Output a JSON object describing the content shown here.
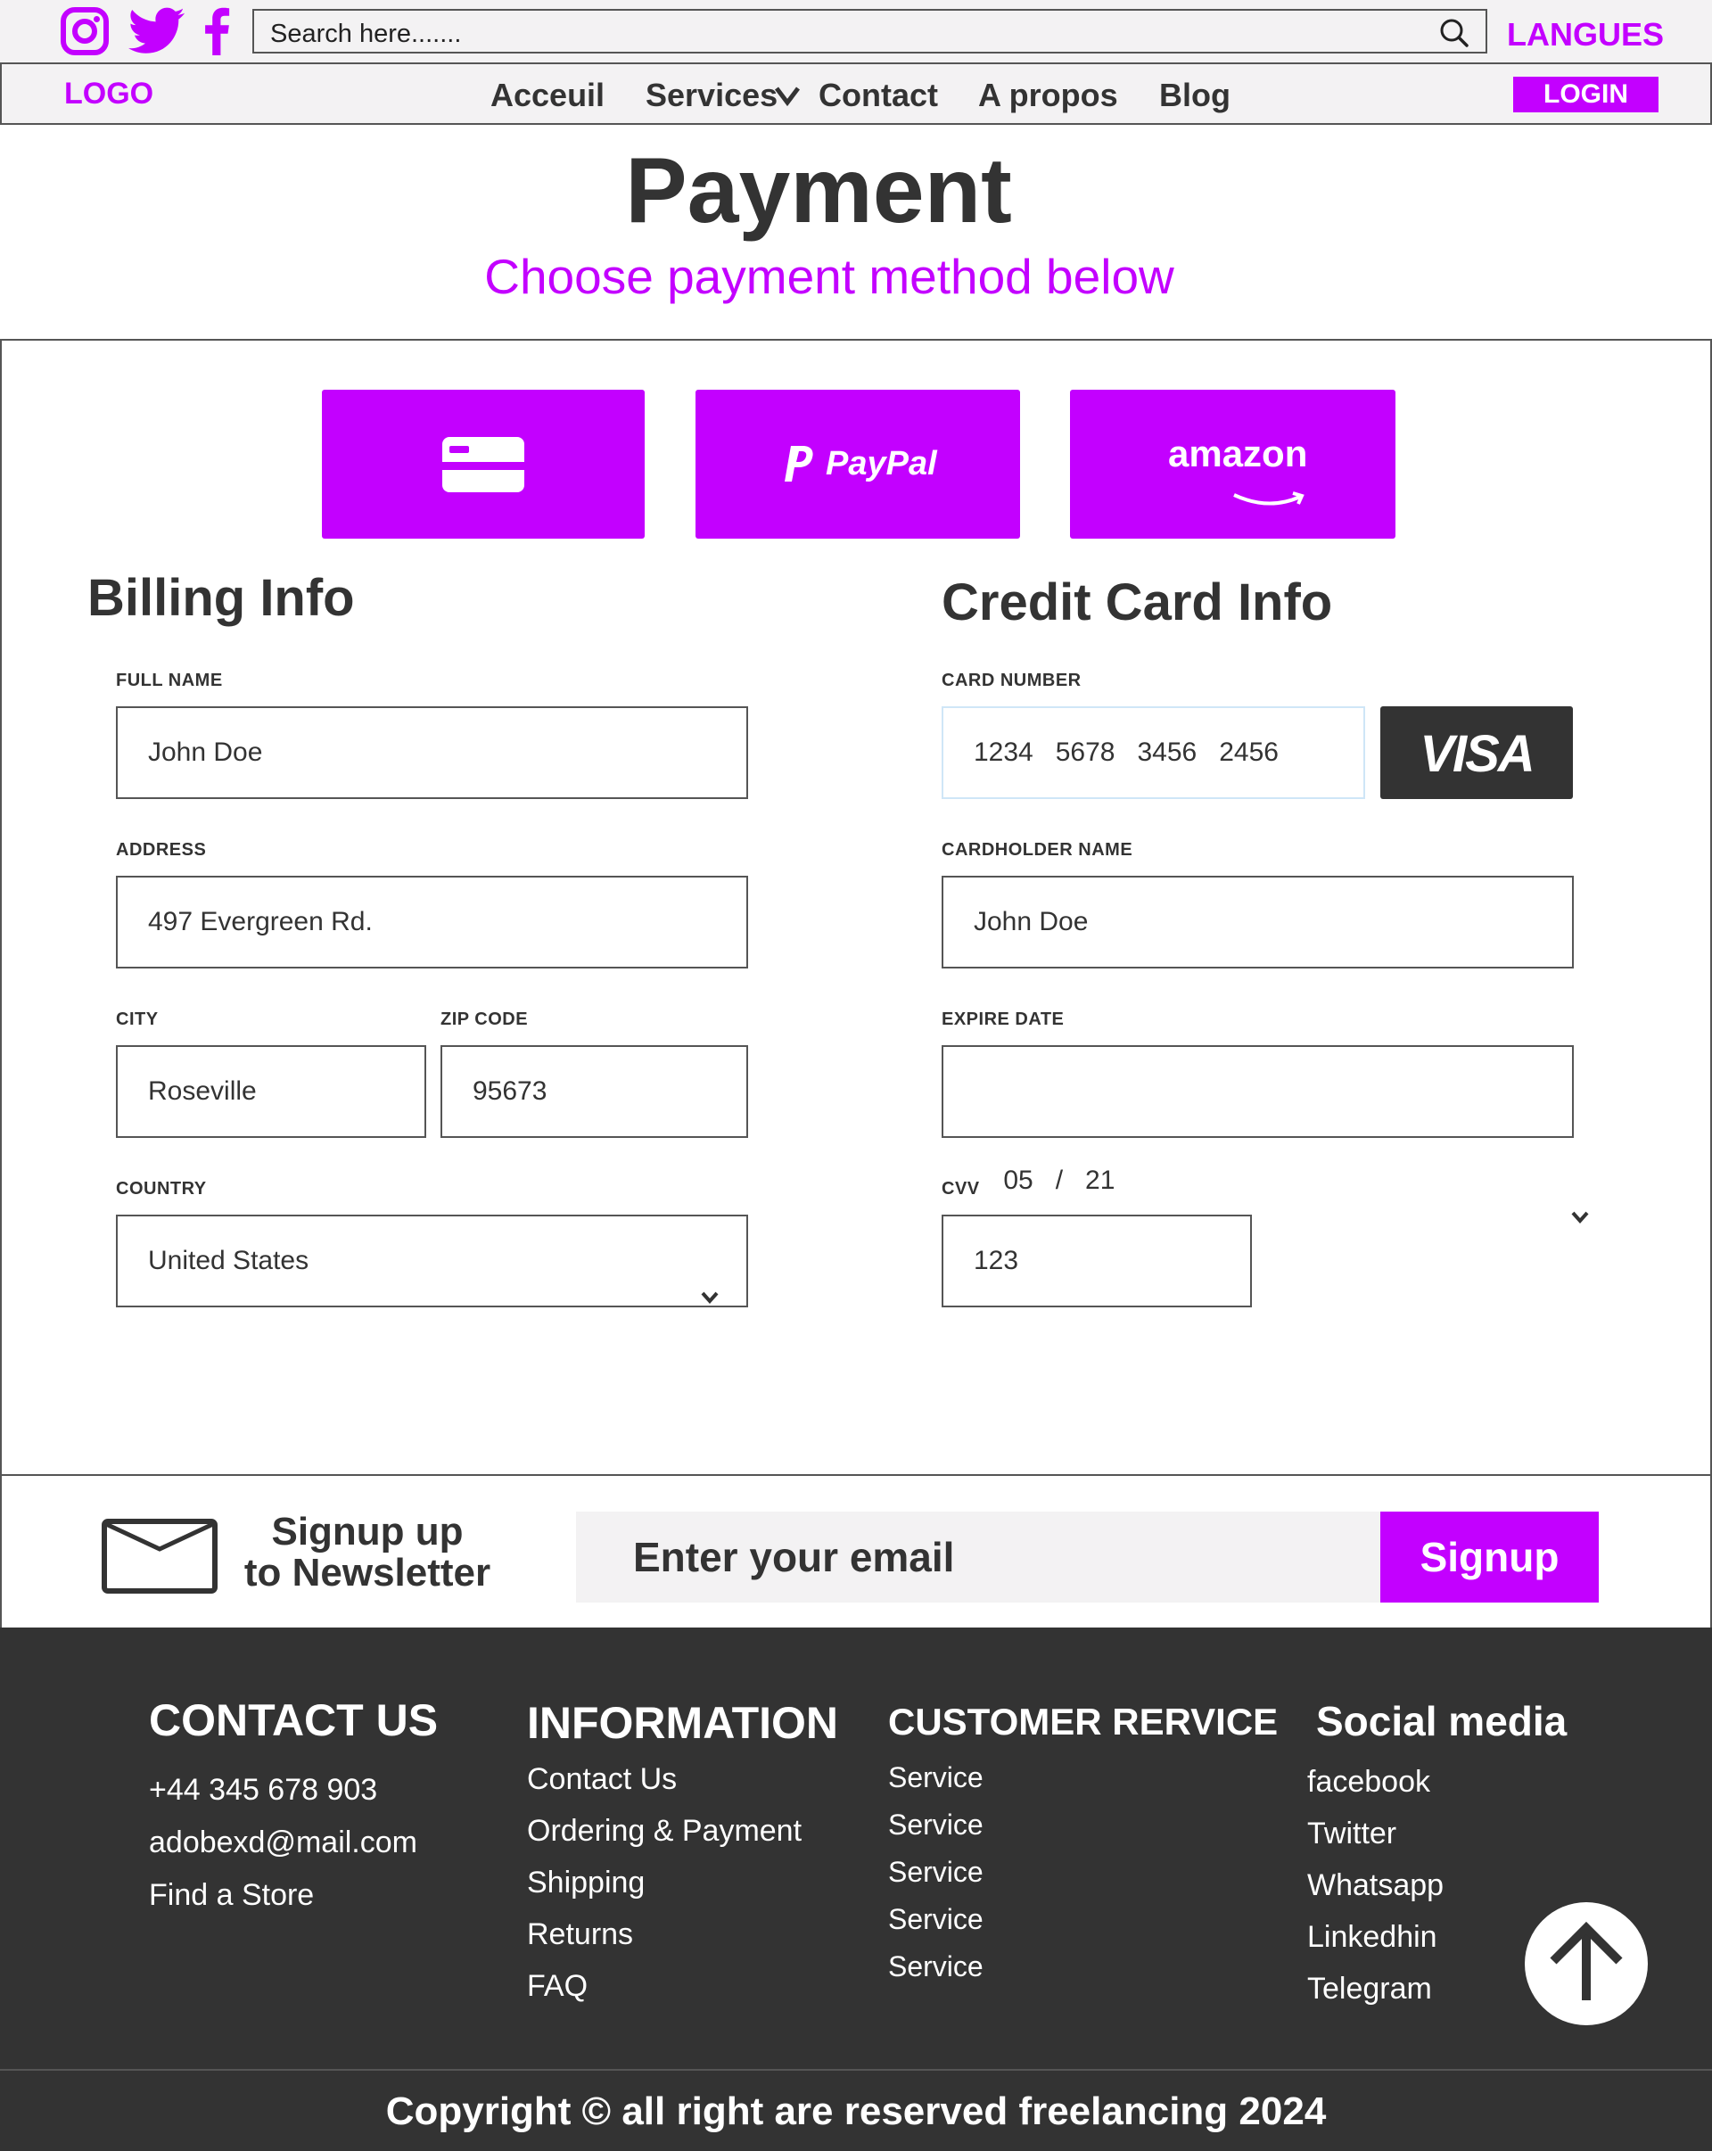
{
  "topbar": {
    "social_icons": [
      "instagram-icon",
      "twitter-icon",
      "facebook-icon"
    ],
    "search_placeholder": "Search here.......",
    "language_label": "LANGUES"
  },
  "nav": {
    "logo": "LOGO",
    "items": [
      "Acceuil",
      "Services",
      "Contact",
      "A propos",
      "Blog"
    ],
    "login_label": "LOGIN"
  },
  "page": {
    "title": "Payment",
    "subtitle": "Choose payment method below"
  },
  "payment_methods": [
    {
      "icon": "credit-card-icon",
      "label": ""
    },
    {
      "icon": "paypal-icon",
      "label": "PayPal"
    },
    {
      "icon": "amazon-icon",
      "label": "amazon"
    }
  ],
  "billing": {
    "title": "Billing Info",
    "full_name_label": "FULL NAME",
    "full_name": "John Doe",
    "address_label": "ADDRESS",
    "address": "497 Evergreen Rd.",
    "city_label": "CITY",
    "city": "Roseville",
    "zip_label": "ZIP CODE",
    "zip": "95673",
    "country_label": "COUNTRY",
    "country": "United States"
  },
  "card": {
    "title": "Credit Card Info",
    "number_label": "CARD NUMBER",
    "number": "1234   5678   3456   2456",
    "brand": "VISA",
    "holder_label": "CARDHOLDER NAME",
    "holder": "John Doe",
    "expire_label": "EXPIRE DATE",
    "expire": "05   /   21",
    "cvv_label": "CVV",
    "cvv": "123"
  },
  "newsletter": {
    "title_line1": "Signup up",
    "title_line2": "to Newsletter",
    "email_placeholder": "Enter your email",
    "button": "Signup"
  },
  "footer": {
    "contact": {
      "title": "CONTACT US",
      "items": [
        "+44 345 678 903",
        "adobexd@mail.com",
        "Find a Store"
      ]
    },
    "information": {
      "title": "INFORMATION",
      "items": [
        "Contact Us",
        "Ordering & Payment",
        "Shipping",
        "Returns",
        "FAQ"
      ]
    },
    "customer_service": {
      "title": "CUSTOMER RERVICE",
      "items": [
        "Service",
        "Service",
        "Service",
        "Service",
        "Service"
      ]
    },
    "social": {
      "title": "Social media",
      "items": [
        "facebook",
        "Twitter",
        "Whatsapp",
        "Linkedhin",
        "Telegram"
      ]
    },
    "copyright": "Copyright © all right are reserved freelancing 2024"
  },
  "colors": {
    "accent": "#c300ff",
    "dark": "#333333",
    "light_bg": "#f3f2f3"
  }
}
